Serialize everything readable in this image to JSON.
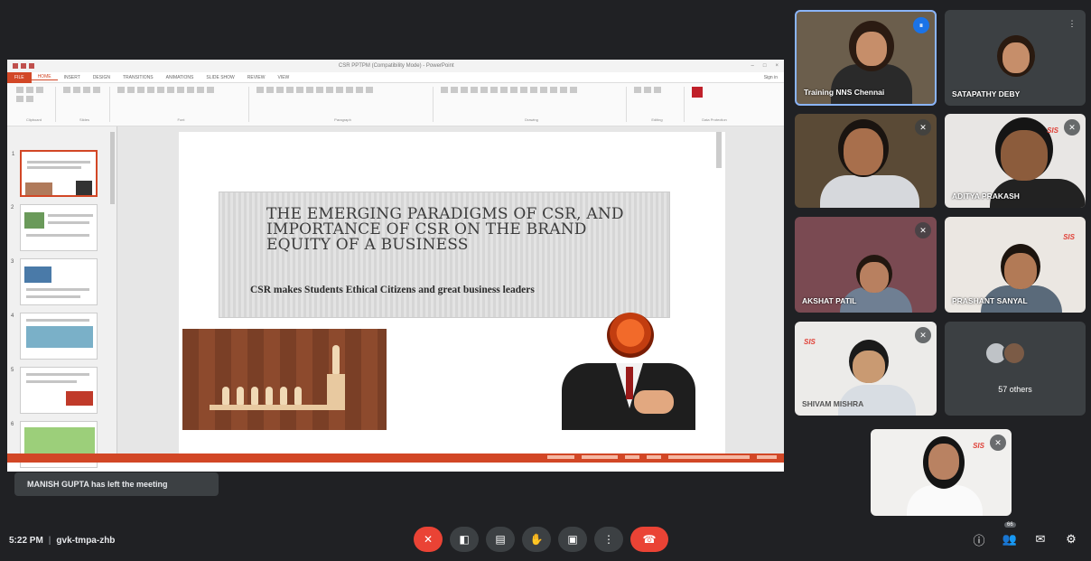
{
  "presentation": {
    "file_title": "CSR PPTPM (Compatibility Mode) - PowerPoint",
    "tabs": [
      "FILE",
      "HOME",
      "INSERT",
      "DESIGN",
      "TRANSITIONS",
      "ANIMATIONS",
      "SLIDE SHOW",
      "REVIEW",
      "VIEW"
    ],
    "sign_in": "Sign in",
    "ribbon_groups": [
      "Clipboard",
      "Slides",
      "Font",
      "Paragraph",
      "Drawing",
      "Editing",
      "Data Protection"
    ],
    "slide_numbers": [
      "1",
      "2",
      "3",
      "4",
      "5",
      "6"
    ],
    "slide": {
      "title": "THE EMERGING PARADIGMS OF CSR, AND IMPORTANCE OF CSR ON THE BRAND EQUITY OF A BUSINESS",
      "subtitle": "CSR makes Students  Ethical Citizens and great business leaders"
    }
  },
  "participants": [
    {
      "name": "Training NNS Chennai",
      "state": "speaking"
    },
    {
      "name": "SATAPATHY DEBY",
      "state": "muted"
    },
    {
      "name": "",
      "state": "muted"
    },
    {
      "name": "ADITYA PRAKASH",
      "state": "muted"
    },
    {
      "name": "AKSHAT PATIL",
      "state": "muted"
    },
    {
      "name": "PRASHANT SANYAL",
      "state": "muted"
    },
    {
      "name": "SHIVAM MISHRA",
      "state": "muted"
    },
    {
      "name": "",
      "state": "muted"
    }
  ],
  "others": {
    "label": "57 others"
  },
  "brand_text": "SIS",
  "toast": "MANISH GUPTA has left the meeting",
  "meeting": {
    "time": "5:22 PM",
    "separator": "|",
    "code": "gvk-tmpa-zhb"
  },
  "controls": [
    {
      "icon": "mic-off-icon",
      "glyph": "✕"
    },
    {
      "icon": "camera-icon",
      "glyph": "◧"
    },
    {
      "icon": "captions-icon",
      "glyph": "▤"
    },
    {
      "icon": "hand-icon",
      "glyph": "✋"
    },
    {
      "icon": "present-icon",
      "glyph": "▣"
    },
    {
      "icon": "more-icon",
      "glyph": "⋮"
    },
    {
      "icon": "end-call-icon",
      "glyph": "☎"
    }
  ],
  "right_controls": [
    {
      "icon": "info-icon",
      "glyph": "ⓘ"
    },
    {
      "icon": "people-icon",
      "glyph": "👥",
      "badge": "66"
    },
    {
      "icon": "chat-icon",
      "glyph": "✉"
    },
    {
      "icon": "activities-icon",
      "glyph": "⚙"
    }
  ],
  "colors": {
    "accent": "#d24726",
    "mic_red": "#ea4335",
    "bg": "#202124",
    "tile": "#3c4043"
  }
}
